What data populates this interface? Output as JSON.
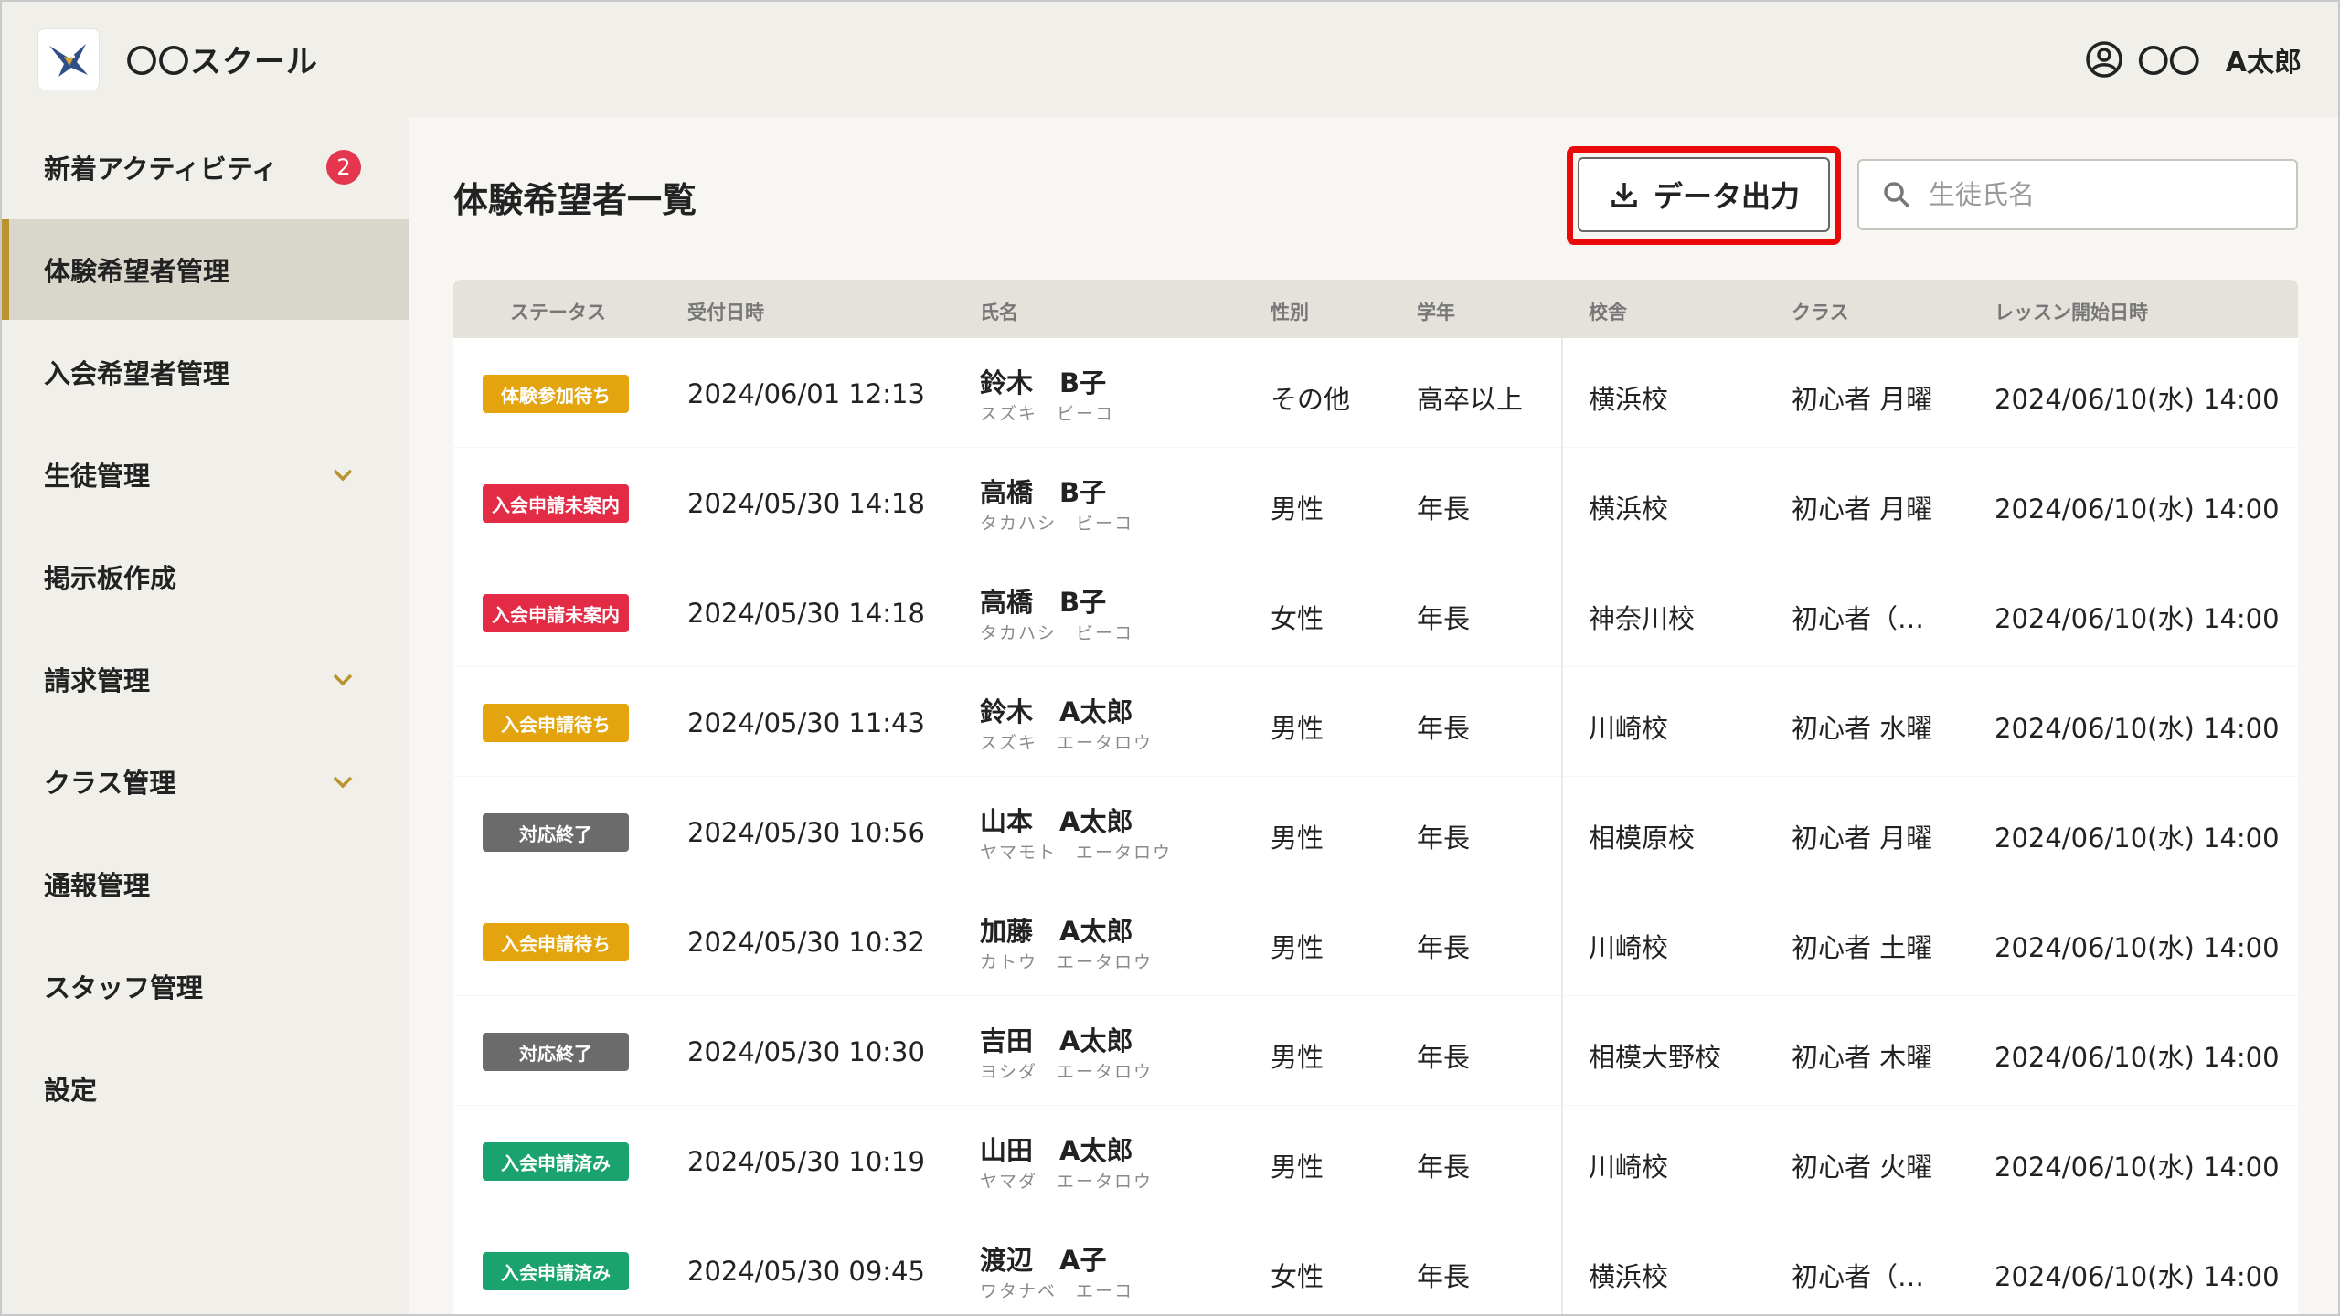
{
  "header": {
    "app_title": "〇〇スクール",
    "user_org": "〇〇",
    "user_name": "A太郎"
  },
  "sidebar": {
    "items": [
      {
        "label": "新着アクティビティ",
        "badge": "2"
      },
      {
        "label": "体験希望者管理",
        "active": true
      },
      {
        "label": "入会希望者管理"
      },
      {
        "label": "生徒管理",
        "expandable": true
      },
      {
        "label": "掲示板作成"
      },
      {
        "label": "請求管理",
        "expandable": true
      },
      {
        "label": "クラス管理",
        "expandable": true
      },
      {
        "label": "通報管理"
      },
      {
        "label": "スタッフ管理"
      },
      {
        "label": "設定"
      }
    ]
  },
  "main": {
    "page_title": "体験希望者一覧",
    "export_label": "データ出力",
    "search_placeholder": "生徒氏名"
  },
  "table": {
    "headers": [
      "ステータス",
      "受付日時",
      "氏名",
      "性別",
      "学年",
      "校舎",
      "クラス",
      "レッスン開始日時"
    ],
    "rows": [
      {
        "status": "体験参加待ち",
        "status_color": "#e3a40d",
        "received": "2024/06/01 12:13",
        "name": "鈴木　B子",
        "kana": "スズキ　ビーコ",
        "gender": "その他",
        "grade": "高卒以上",
        "school": "横浜校",
        "class": "初心者 月曜",
        "lesson": "2024/06/10(水) 14:00"
      },
      {
        "status": "入会申請未案内",
        "status_color": "#e32b45",
        "received": "2024/05/30 14:18",
        "name": "高橋　B子",
        "kana": "タカハシ　ビーコ",
        "gender": "男性",
        "grade": "年長",
        "school": "横浜校",
        "class": "初心者 月曜",
        "lesson": "2024/06/10(水) 14:00"
      },
      {
        "status": "入会申請未案内",
        "status_color": "#e32b45",
        "received": "2024/05/30 14:18",
        "name": "高橋　B子",
        "kana": "タカハシ　ビーコ",
        "gender": "女性",
        "grade": "年長",
        "school": "神奈川校",
        "class": "初心者（…",
        "lesson": "2024/06/10(水) 14:00"
      },
      {
        "status": "入会申請待ち",
        "status_color": "#e3a40d",
        "received": "2024/05/30 11:43",
        "name": "鈴木　A太郎",
        "kana": "スズキ　エータロウ",
        "gender": "男性",
        "grade": "年長",
        "school": "川崎校",
        "class": "初心者 水曜",
        "lesson": "2024/06/10(水) 14:00"
      },
      {
        "status": "対応終了",
        "status_color": "#6b6b6b",
        "received": "2024/05/30 10:56",
        "name": "山本　A太郎",
        "kana": "ヤマモト　エータロウ",
        "gender": "男性",
        "grade": "年長",
        "school": "相模原校",
        "class": "初心者 月曜",
        "lesson": "2024/06/10(水) 14:00"
      },
      {
        "status": "入会申請待ち",
        "status_color": "#e3a40d",
        "received": "2024/05/30 10:32",
        "name": "加藤　A太郎",
        "kana": "カトウ　エータロウ",
        "gender": "男性",
        "grade": "年長",
        "school": "川崎校",
        "class": "初心者 土曜",
        "lesson": "2024/06/10(水) 14:00"
      },
      {
        "status": "対応終了",
        "status_color": "#6b6b6b",
        "received": "2024/05/30 10:30",
        "name": "吉田　A太郎",
        "kana": "ヨシダ　エータロウ",
        "gender": "男性",
        "grade": "年長",
        "school": "相模大野校",
        "class": "初心者 木曜",
        "lesson": "2024/06/10(水) 14:00"
      },
      {
        "status": "入会申請済み",
        "status_color": "#1aa36f",
        "received": "2024/05/30 10:19",
        "name": "山田　A太郎",
        "kana": "ヤマダ　エータロウ",
        "gender": "男性",
        "grade": "年長",
        "school": "川崎校",
        "class": "初心者 火曜",
        "lesson": "2024/06/10(水) 14:00"
      },
      {
        "status": "入会申請済み",
        "status_color": "#1aa36f",
        "received": "2024/05/30 09:45",
        "name": "渡辺　A子",
        "kana": "ワタナベ　エーコ",
        "gender": "女性",
        "grade": "年長",
        "school": "横浜校",
        "class": "初心者（…",
        "lesson": "2024/06/10(水) 14:00"
      }
    ]
  }
}
